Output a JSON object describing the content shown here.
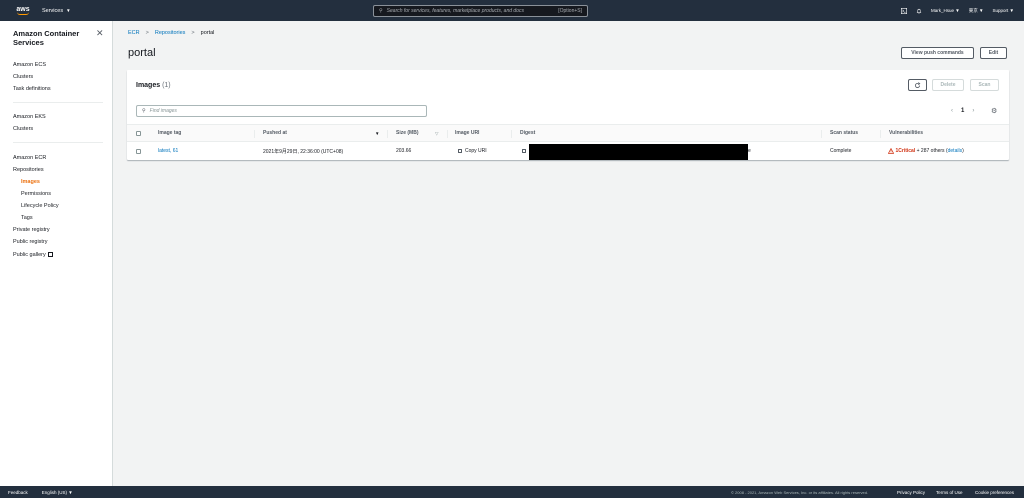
{
  "topnav": {
    "logo": "aws",
    "services_label": "Services",
    "search_placeholder": "Search for services, features, marketplace products, and docs",
    "search_shortcut": "[Option+S]",
    "user": "Mark_Hsue",
    "region": "東京",
    "support": "Support"
  },
  "sidebar": {
    "title": "Amazon Container Services",
    "ecs": {
      "heading": "Amazon ECS",
      "items": [
        "Clusters",
        "Task definitions"
      ]
    },
    "eks": {
      "heading": "Amazon EKS",
      "items": [
        "Clusters"
      ]
    },
    "ecr": {
      "heading": "Amazon ECR",
      "repositories": "Repositories",
      "sub": [
        "Images",
        "Permissions",
        "Lifecycle Policy",
        "Tags"
      ],
      "active": "Images"
    },
    "registries": [
      "Private registry",
      "Public registry",
      "Public gallery"
    ]
  },
  "breadcrumb": [
    "ECR",
    "Repositories",
    "portal"
  ],
  "page": {
    "title": "portal",
    "view_push_commands": "View push commands",
    "edit": "Edit"
  },
  "images_panel": {
    "title": "Images",
    "count": "(1)",
    "delete": "Delete",
    "scan": "Scan",
    "find_placeholder": "Find images",
    "page": "1",
    "columns": [
      "Image tag",
      "Pushed at",
      "Size (MB)",
      "Image URI",
      "Digest",
      "Scan status",
      "Vulnerabilities"
    ],
    "rows": [
      {
        "image_tag": "latest, 61",
        "pushed_at": "2021年9月29日, 22:36:00 (UTC+08)",
        "size": "203.66",
        "uri": "Copy URI",
        "digest_tail": "e",
        "scan_status": "Complete",
        "vuln_critical": "1Critical",
        "vuln_rest": " + 287 others (",
        "vuln_details": "details",
        "vuln_close": ")"
      }
    ]
  },
  "footer": {
    "feedback": "Feedback",
    "language": "English (US)",
    "copyright": "© 2008 - 2021, Amazon Web Services, Inc. or its affiliates. All rights reserved.",
    "privacy": "Privacy Policy",
    "terms": "Terms of Use",
    "cookies": "Cookie preferences"
  },
  "colors": {
    "nav_bg": "#232f3e",
    "link": "#0073bb",
    "active": "#ec7211",
    "critical": "#d13212"
  }
}
